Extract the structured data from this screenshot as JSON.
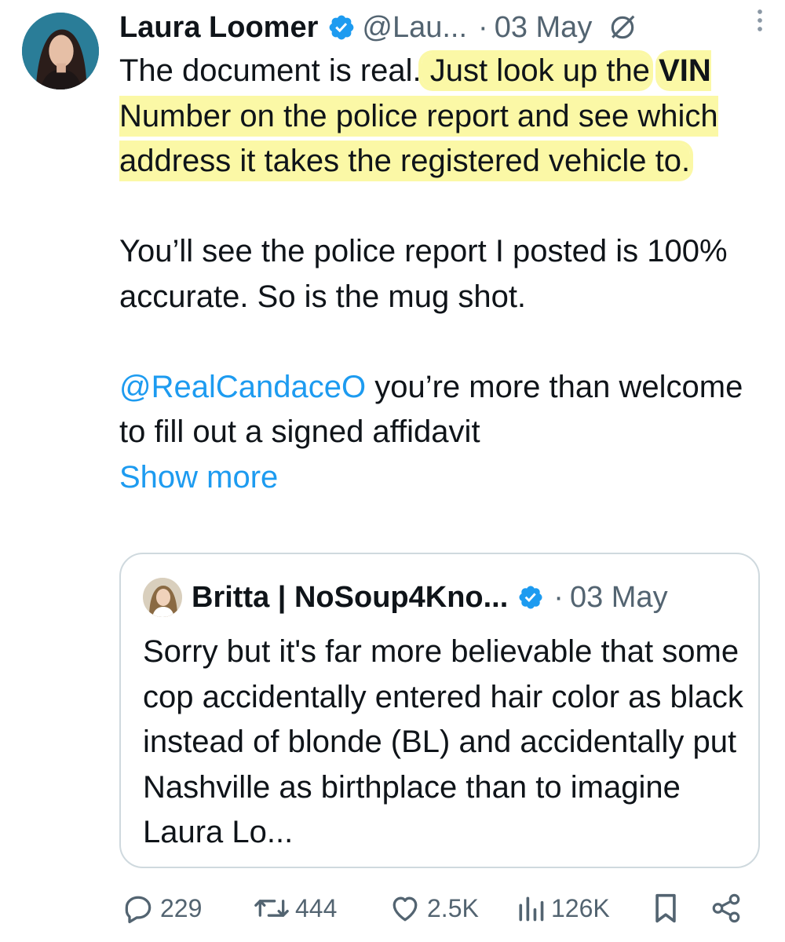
{
  "tweet": {
    "author_name": "Laura Loomer",
    "handle": "@Lau...",
    "separator": "·",
    "time": "03 May",
    "body_lines": {
      "p1_a": "The document is real.",
      "p1_b": " Just look up the",
      "vin": "VIN",
      "p1_c": " Number on the police report and see which address it takes the registered vehicle to.",
      "p2": "You’ll see the police report I posted is 100% accurate. So is the mug shot.",
      "p3_mention": "@RealCandaceO",
      "p3_rest": " you’re more than welcome to fill out a signed affidavit"
    },
    "show_more": "Show more",
    "icons": {
      "verified": "verified-badge-icon",
      "grok": "grok-icon",
      "more": "more-vertical-icon"
    }
  },
  "quote": {
    "author_name": "Britta | NoSoup4Kno...",
    "separator": "·",
    "time": "03 May",
    "text": "Sorry but it's far more believable that some cop accidentally entered hair color as black instead of blonde (BL) and accidentally put Nashville as birthplace than to imagine Laura Lo..."
  },
  "actions": {
    "replies": "229",
    "reposts": "444",
    "likes": "2.5K",
    "views": "126K"
  },
  "colors": {
    "accent": "#1d9bf0",
    "secondary_text": "#536471",
    "highlight": "#fbf8a6",
    "border": "#cfd9de"
  }
}
